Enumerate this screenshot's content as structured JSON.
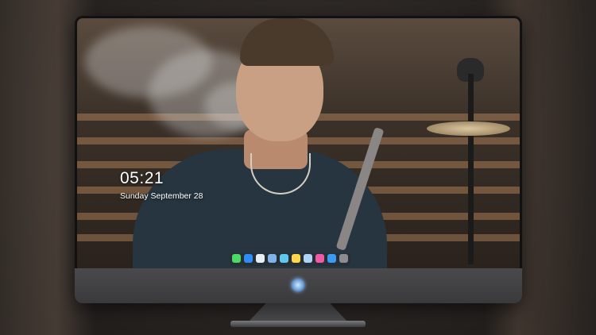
{
  "lock_screen": {
    "time": "05:21",
    "date": "Sunday September  28"
  },
  "dock": {
    "icons": [
      {
        "name": "messages-icon",
        "color": "#4cd964"
      },
      {
        "name": "mail-icon",
        "color": "#2f8cf6"
      },
      {
        "name": "safari-icon",
        "color": "#e9eef5"
      },
      {
        "name": "finder-icon",
        "color": "#7fb2e8"
      },
      {
        "name": "clips-icon",
        "color": "#5ec8f0"
      },
      {
        "name": "notes-icon",
        "color": "#ffd84a"
      },
      {
        "name": "preview-icon",
        "color": "#aed4f5"
      },
      {
        "name": "music-icon",
        "color": "#f05aa5"
      },
      {
        "name": "app-store-icon",
        "color": "#3a9bf5"
      },
      {
        "name": "screenshot-icon",
        "color": "#8c8c90"
      }
    ]
  }
}
